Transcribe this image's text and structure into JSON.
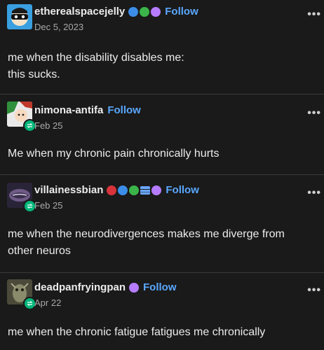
{
  "posts": [
    {
      "username": "etherealspacejelly",
      "follow_label": "Follow",
      "date": "Dec 5, 2023",
      "body_lines": [
        "me when the disability disables me:",
        "this sucks."
      ],
      "badges": [
        "blue",
        "green",
        "purple"
      ],
      "reblog": false,
      "avatar_icon": "masked-face-avatar"
    },
    {
      "username": "nimona-antifa",
      "follow_label": "Follow",
      "date": "Feb 25",
      "body_lines": [
        "Me when my chronic pain chronically hurts"
      ],
      "badges": [],
      "reblog": true,
      "avatar_icon": "cartoon-character-avatar"
    },
    {
      "username": "villainessbian",
      "follow_label": "Follow",
      "date": "Feb 25",
      "body_lines": [
        "me when the neurodivergences makes me diverge from",
        "other neuros"
      ],
      "badges": [
        "red",
        "blue",
        "green",
        "stack",
        "purple"
      ],
      "reblog": true,
      "avatar_icon": "lips-avatar"
    },
    {
      "username": "deadpanfryingpan",
      "follow_label": "Follow",
      "date": "Apr 22",
      "body_lines": [
        "me when the chronic fatigue fatigues me chronically"
      ],
      "badges": [
        "purple"
      ],
      "reblog": true,
      "avatar_icon": "creature-avatar"
    }
  ],
  "menu_glyph": "•••",
  "colors": {
    "background": "#1a1a1a",
    "text": "#ececec",
    "link": "#5aa8ff",
    "muted": "#a8a8a8",
    "reblog_green": "#00b67a"
  }
}
